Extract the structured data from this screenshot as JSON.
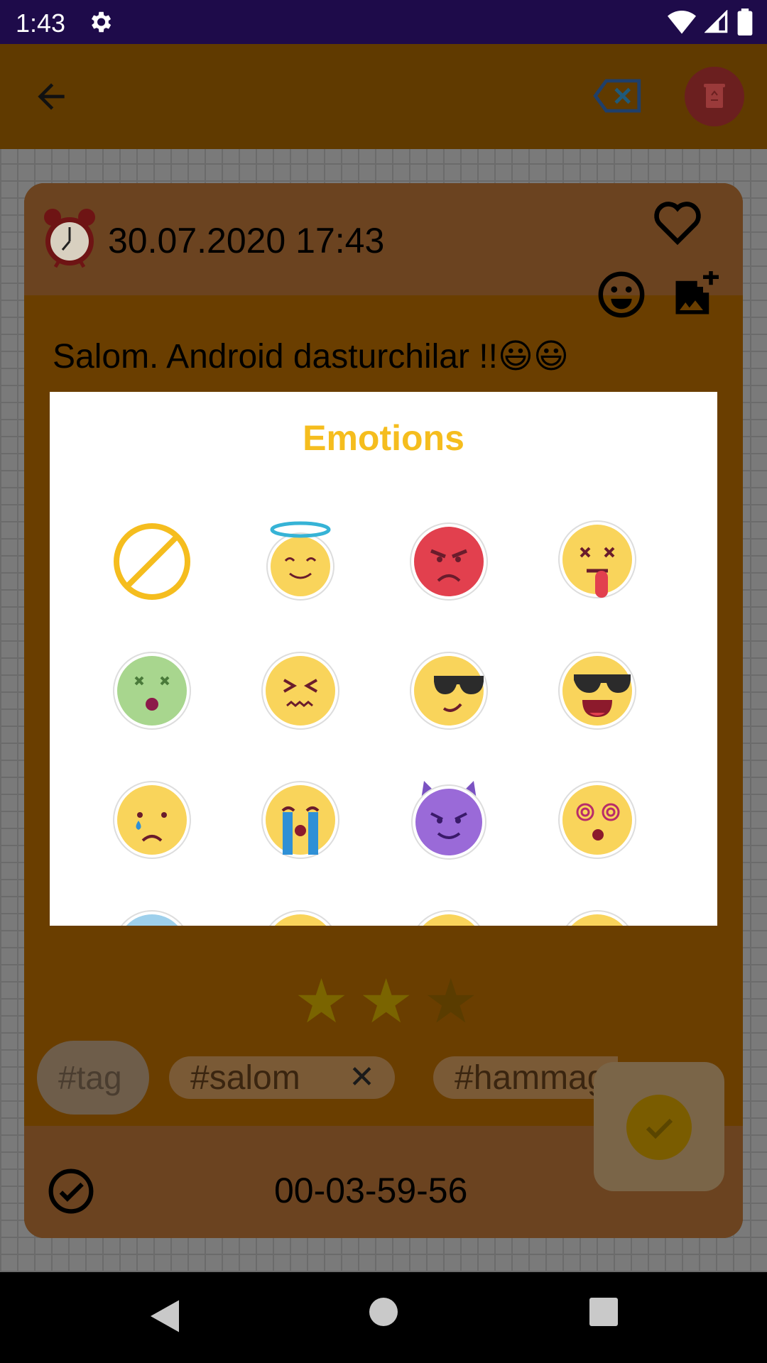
{
  "status_bar": {
    "time": "1:43"
  },
  "note": {
    "date": "30.07.2020 17:43",
    "text": "Salom. Android dasturchilar !!😃😃",
    "rating": 2,
    "rating_max": 3,
    "tag_placeholder": "#tag",
    "tags": [
      "#salom",
      "#hammag"
    ],
    "timer": "00-03-59-56"
  },
  "dialog": {
    "title": "Emotions",
    "emotions": [
      "none",
      "angel",
      "angry",
      "dizzy-tongue",
      "sick",
      "tired",
      "cool-smirk",
      "cool-laugh",
      "sad-tear",
      "crying",
      "devil",
      "hypnotized",
      "cold",
      "happy",
      "happy",
      "happy"
    ]
  },
  "colors": {
    "accent": "#f5bd1e",
    "toolbar": "#603a00",
    "card": "#6a3e00",
    "status_bar": "#1e0b4a"
  }
}
